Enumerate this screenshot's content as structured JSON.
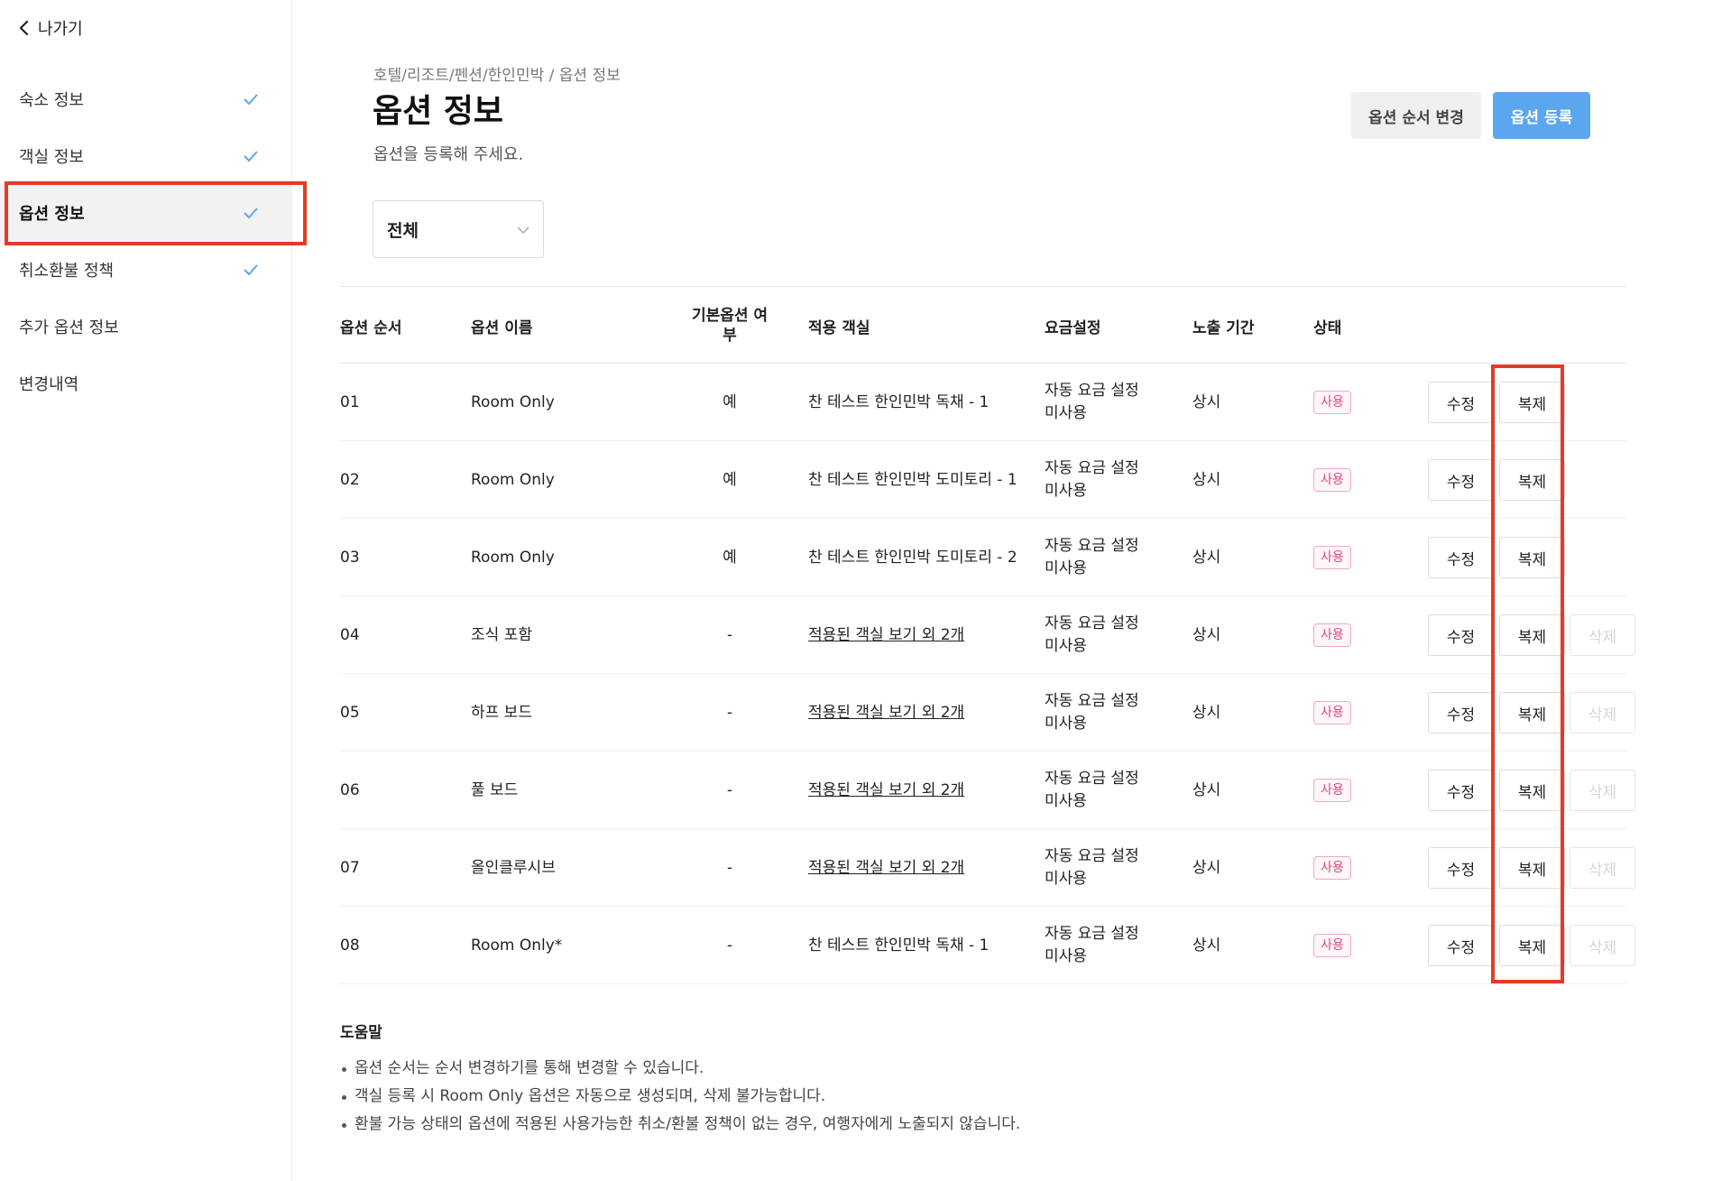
{
  "sidebar": {
    "back_label": "나가기",
    "items": [
      {
        "label": "숙소 정보",
        "checked": true,
        "active": false
      },
      {
        "label": "객실 정보",
        "checked": true,
        "active": false
      },
      {
        "label": "옵션 정보",
        "checked": true,
        "active": true
      },
      {
        "label": "취소환불 정책",
        "checked": true,
        "active": false
      },
      {
        "label": "추가 옵션 정보",
        "checked": false,
        "active": false
      },
      {
        "label": "변경내역",
        "checked": false,
        "active": false
      }
    ],
    "check_color": "#5aa7f0"
  },
  "header": {
    "breadcrumb": "호텔/리조트/펜션/한인민박 / 옵션 정보",
    "title": "옵션 정보",
    "subtitle": "옵션을 등록해 주세요.",
    "order_button": "옵션 순서 변경",
    "register_button": "옵션 등록"
  },
  "filter": {
    "selected": "전체"
  },
  "table": {
    "headers": {
      "order": "옵션 순서",
      "name": "옵션 이름",
      "default_line1": "기본옵션 여",
      "default_line2": "부",
      "rooms": "적용 객실",
      "fee": "요금설정",
      "period": "노출 기간",
      "status": "상태"
    },
    "buttons": {
      "edit": "수정",
      "copy": "복제",
      "delete": "삭제"
    },
    "rows": [
      {
        "order": "01",
        "name": "Room Only",
        "default": "예",
        "rooms": "찬 테스트 한인민박 독채 - 1",
        "rooms_link": false,
        "fee_line1": "자동 요금 설정",
        "fee_line2": "미사용",
        "period": "상시",
        "status": "사용",
        "deletable": false
      },
      {
        "order": "02",
        "name": "Room Only",
        "default": "예",
        "rooms": "찬 테스트 한인민박 도미토리 - 1",
        "rooms_link": false,
        "fee_line1": "자동 요금 설정",
        "fee_line2": "미사용",
        "period": "상시",
        "status": "사용",
        "deletable": false
      },
      {
        "order": "03",
        "name": "Room Only",
        "default": "예",
        "rooms": "찬 테스트 한인민박 도미토리 - 2",
        "rooms_link": false,
        "fee_line1": "자동 요금 설정",
        "fee_line2": "미사용",
        "period": "상시",
        "status": "사용",
        "deletable": false
      },
      {
        "order": "04",
        "name": "조식 포함",
        "default": "-",
        "rooms": "적용된 객실 보기 외 2개",
        "rooms_link": true,
        "fee_line1": "자동 요금 설정",
        "fee_line2": "미사용",
        "period": "상시",
        "status": "사용",
        "deletable": true
      },
      {
        "order": "05",
        "name": "하프 보드",
        "default": "-",
        "rooms": "적용된 객실 보기 외 2개",
        "rooms_link": true,
        "fee_line1": "자동 요금 설정",
        "fee_line2": "미사용",
        "period": "상시",
        "status": "사용",
        "deletable": true
      },
      {
        "order": "06",
        "name": "풀 보드",
        "default": "-",
        "rooms": "적용된 객실 보기 외 2개",
        "rooms_link": true,
        "fee_line1": "자동 요금 설정",
        "fee_line2": "미사용",
        "period": "상시",
        "status": "사용",
        "deletable": true
      },
      {
        "order": "07",
        "name": "올인클루시브",
        "default": "-",
        "rooms": "적용된 객실 보기 외 2개",
        "rooms_link": true,
        "fee_line1": "자동 요금 설정",
        "fee_line2": "미사용",
        "period": "상시",
        "status": "사용",
        "deletable": true
      },
      {
        "order": "08",
        "name": "Room Only*",
        "default": "-",
        "rooms": "찬 테스트 한인민박 독채 - 1",
        "rooms_link": false,
        "fee_line1": "자동 요금 설정",
        "fee_line2": "미사용",
        "period": "상시",
        "status": "사용",
        "deletable": true
      }
    ]
  },
  "help": {
    "title": "도움말",
    "items": [
      "옵션 순서는 순서 변경하기를 통해 변경할 수 있습니다.",
      "객실 등록 시 Room Only 옵션은 자동으로 생성되며, 삭제 불가능합니다.",
      "환불 가능 상태의 옵션에 적용된 사용가능한 취소/환불 정책이 없는 경우, 여행자에게 노출되지 않습니다."
    ]
  },
  "colors": {
    "accent": "#5aa7f0",
    "highlight": "#e33b26",
    "status_badge": "#e0457e"
  }
}
